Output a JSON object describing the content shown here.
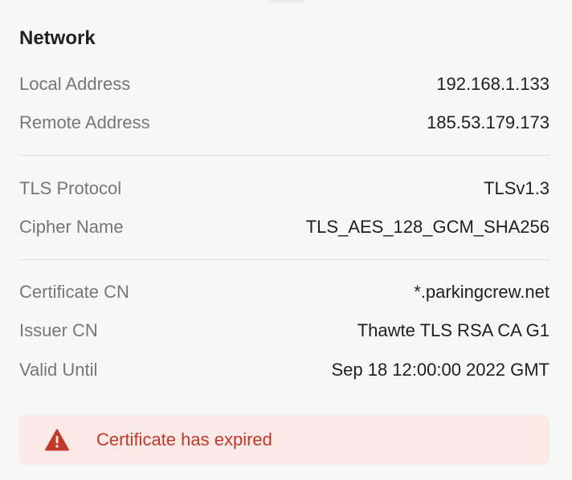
{
  "network": {
    "title": "Network",
    "connection": [
      {
        "label": "Local Address",
        "value": "192.168.1.133"
      },
      {
        "label": "Remote Address",
        "value": "185.53.179.173"
      }
    ],
    "tls": [
      {
        "label": "TLS Protocol",
        "value": "TLSv1.3"
      },
      {
        "label": "Cipher Name",
        "value": "TLS_AES_128_GCM_SHA256"
      }
    ],
    "certificate": [
      {
        "label": "Certificate CN",
        "value": "*.parkingcrew.net"
      },
      {
        "label": "Issuer CN",
        "value": "Thawte TLS RSA CA G1"
      },
      {
        "label": "Valid Until",
        "value": "Sep 18 12:00:00 2022 GMT"
      }
    ]
  },
  "warning": {
    "message": "Certificate has expired",
    "icon": "warning-triangle-icon"
  },
  "colors": {
    "background": "#f7f7f7",
    "label": "#767676",
    "value": "#1f1f1f",
    "warning_bg": "#fbe9e7",
    "warning_text": "#c0392b"
  }
}
